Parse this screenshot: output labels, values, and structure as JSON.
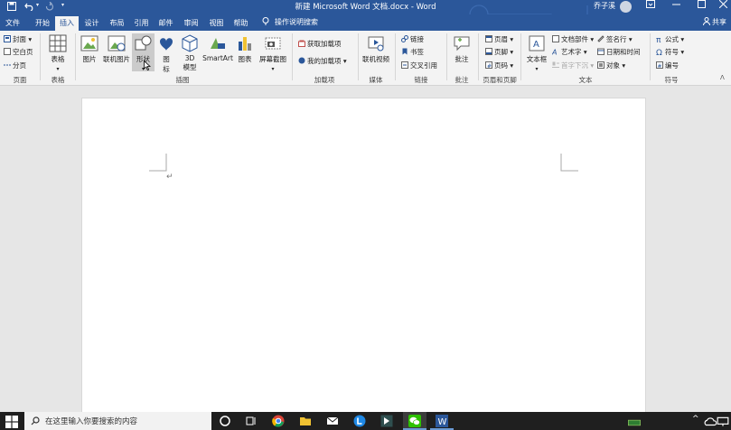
{
  "title_bar": {
    "document_title": "新建 Microsoft Word 文档.docx - Word",
    "user_name": "乔子溪",
    "save_icon": "save-icon",
    "undo_icon": "undo-icon",
    "redo_icon": "redo-icon"
  },
  "tabs": [
    {
      "label": "文件"
    },
    {
      "label": "开始"
    },
    {
      "label": "插入",
      "active": true
    },
    {
      "label": "设计"
    },
    {
      "label": "布局"
    },
    {
      "label": "引用"
    },
    {
      "label": "邮件"
    },
    {
      "label": "审阅"
    },
    {
      "label": "视图"
    },
    {
      "label": "帮助"
    }
  ],
  "tell_me": "操作说明搜索",
  "share": "共享",
  "ribbon": {
    "pages": {
      "cover": "封面",
      "blank": "空白页",
      "break": "分页",
      "group": "页面"
    },
    "tables": {
      "table": "表格",
      "group": "表格"
    },
    "illustrations": {
      "picture": "图片",
      "online_picture": "联机图片",
      "shapes": "形状",
      "icons_1": "图",
      "icons_2": "标",
      "model_1": "3D",
      "model_2": "模型",
      "smartart": "SmartArt",
      "chart": "图表",
      "screenshot": "屏幕截图",
      "group": "插图"
    },
    "addins": {
      "get": "获取加载项",
      "my": "我的加载项",
      "group": "加载项"
    },
    "media": {
      "online_video": "联机视频",
      "group": "媒体"
    },
    "links": {
      "link": "链接",
      "bookmark": "书签",
      "cross_ref": "交叉引用",
      "group": "链接"
    },
    "comments": {
      "comment": "批注",
      "group": "批注"
    },
    "header_footer": {
      "header": "页眉",
      "footer": "页脚",
      "page_number": "页码",
      "group": "页眉和页脚"
    },
    "text": {
      "text_box": "文本框",
      "quick_parts": "文档部件",
      "wordart": "艺术字",
      "drop_cap": "首字下沉",
      "signature": "签名行",
      "date_time": "日期和时间",
      "object": "对象",
      "group": "文本"
    },
    "symbols": {
      "equation": "公式",
      "symbol": "符号",
      "number": "编号",
      "group": "符号"
    }
  },
  "taskbar": {
    "search_placeholder": "在这里输入你要搜索的内容"
  },
  "colors": {
    "accent": "#2b579a",
    "ribbon_bg": "#f3f3f3",
    "doc_bg": "#e6e6e6",
    "taskbar": "#1f1f1f"
  }
}
